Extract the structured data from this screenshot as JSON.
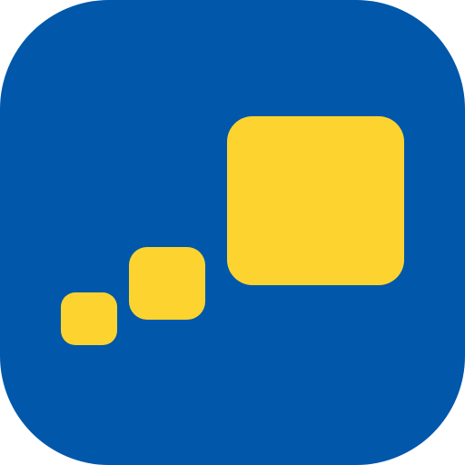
{
  "icon": {
    "name": "app-icon",
    "background_color": "#0157AA",
    "accent_color": "#FDD42F",
    "shapes": [
      "small-square",
      "medium-square",
      "large-square"
    ]
  }
}
